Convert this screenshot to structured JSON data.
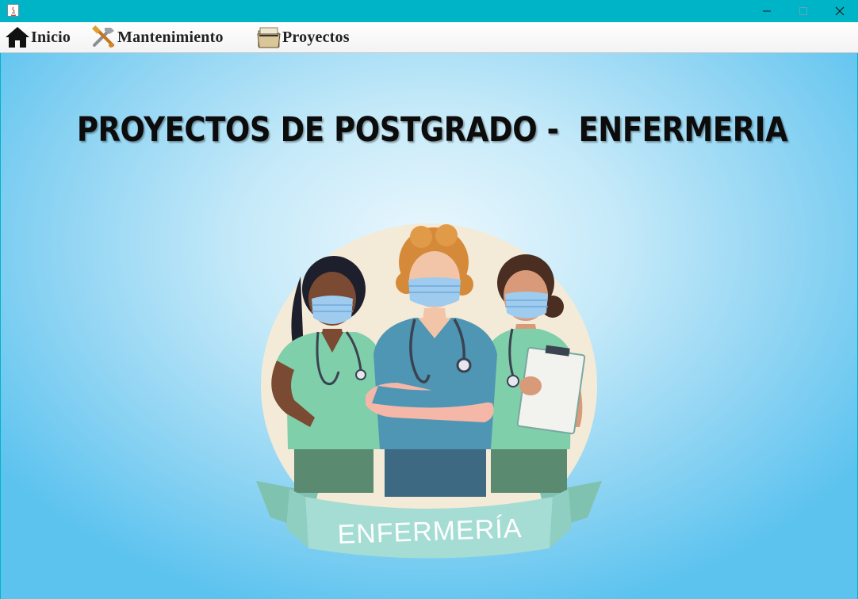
{
  "window": {
    "controls": {
      "minimize_icon": "minimize-icon",
      "maximize_icon": "maximize-icon",
      "close_icon": "close-icon"
    }
  },
  "menubar": {
    "items": [
      {
        "label": "Inicio",
        "icon": "home-icon"
      },
      {
        "label": "Mantenimiento",
        "icon": "tools-icon"
      },
      {
        "label": "Proyectos",
        "icon": "folder-icon"
      }
    ]
  },
  "main": {
    "title": "PROYECTOS DE POSTGRADO -  ENFERMERIA",
    "banner_text": "ENFERMERÍA"
  },
  "colors": {
    "titlebar": "#00b4c8",
    "background_center": "#eaf7fd",
    "background_edge": "#5cc3ef"
  }
}
